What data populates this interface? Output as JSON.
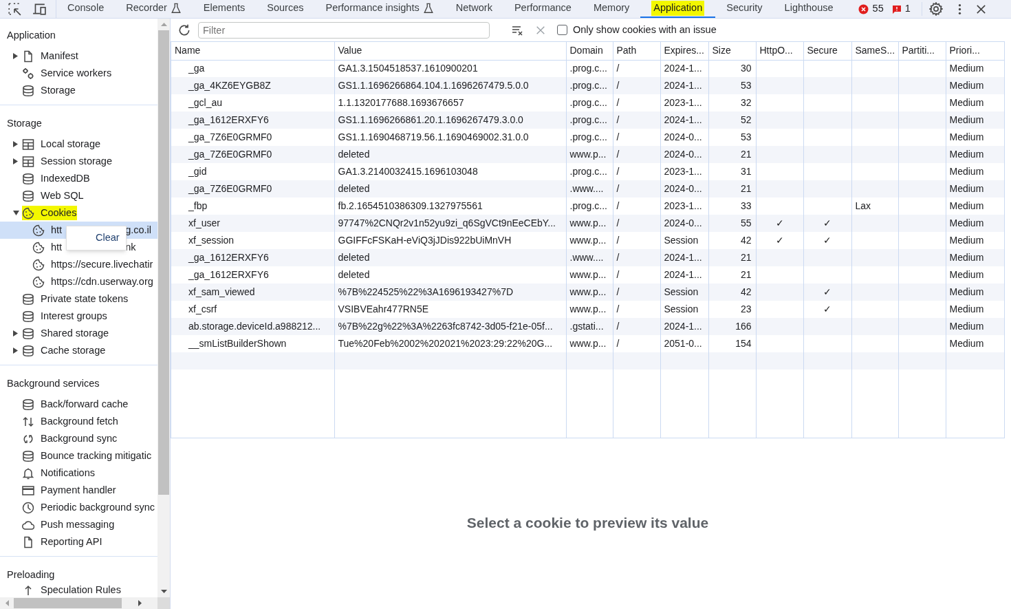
{
  "tabs": [
    {
      "label": "Console",
      "selected": false,
      "experimental": false,
      "highlighted": false
    },
    {
      "label": "Recorder",
      "selected": false,
      "experimental": true,
      "highlighted": false
    },
    {
      "label": "Elements",
      "selected": false,
      "experimental": false,
      "highlighted": false
    },
    {
      "label": "Sources",
      "selected": false,
      "experimental": false,
      "highlighted": false
    },
    {
      "label": "Performance insights",
      "selected": false,
      "experimental": true,
      "highlighted": false
    },
    {
      "label": "Network",
      "selected": false,
      "experimental": false,
      "highlighted": false
    },
    {
      "label": "Performance",
      "selected": false,
      "experimental": false,
      "highlighted": false
    },
    {
      "label": "Memory",
      "selected": false,
      "experimental": false,
      "highlighted": false
    },
    {
      "label": "Application",
      "selected": true,
      "experimental": false,
      "highlighted": true
    },
    {
      "label": "Security",
      "selected": false,
      "experimental": false,
      "highlighted": false
    },
    {
      "label": "Lighthouse",
      "selected": false,
      "experimental": false,
      "highlighted": false
    }
  ],
  "counters": {
    "errors": "55",
    "issues": "1"
  },
  "sidebar": {
    "sections": [
      {
        "title": "Application",
        "items": [
          {
            "label": "Manifest",
            "kind": "file",
            "expanded": false
          },
          {
            "label": "Service workers",
            "kind": "gears"
          },
          {
            "label": "Storage",
            "kind": "database"
          }
        ]
      },
      {
        "title": "Storage",
        "items": [
          {
            "label": "Local storage",
            "kind": "grid",
            "expanded": false
          },
          {
            "label": "Session storage",
            "kind": "grid",
            "expanded": false
          },
          {
            "label": "IndexedDB",
            "kind": "database"
          },
          {
            "label": "Web SQL",
            "kind": "database"
          },
          {
            "label": "Cookies",
            "kind": "cookie",
            "expanded": true,
            "highlighted": true,
            "children": [
              {
                "label_start": "htt",
                "label_end": "g.co.il",
                "selected": true
              },
              {
                "label_start": "htt",
                "label_end": "nk",
                "selected": false
              },
              {
                "label_start": "https://secure.livechatir",
                "selected": false
              },
              {
                "label_start": "https://cdn.userway.org",
                "selected": false
              }
            ]
          },
          {
            "label": "Private state tokens",
            "kind": "database"
          },
          {
            "label": "Interest groups",
            "kind": "database"
          },
          {
            "label": "Shared storage",
            "kind": "database",
            "expanded": false
          },
          {
            "label": "Cache storage",
            "kind": "database",
            "expanded": false
          }
        ]
      },
      {
        "title": "Background services",
        "items": [
          {
            "label": "Back/forward cache",
            "kind": "database"
          },
          {
            "label": "Background fetch",
            "kind": "updown"
          },
          {
            "label": "Background sync",
            "kind": "sync"
          },
          {
            "label": "Bounce tracking mitigatic",
            "kind": "database"
          },
          {
            "label": "Notifications",
            "kind": "bell"
          },
          {
            "label": "Payment handler",
            "kind": "card"
          },
          {
            "label": "Periodic background sync",
            "kind": "clock"
          },
          {
            "label": "Push messaging",
            "kind": "cloud"
          },
          {
            "label": "Reporting API",
            "kind": "file"
          }
        ]
      },
      {
        "title": "Preloading",
        "items": [
          {
            "label": "Speculation Rules",
            "kind": "up"
          }
        ]
      }
    ]
  },
  "context_menu": {
    "items": [
      "Clear"
    ]
  },
  "filter": {
    "placeholder": "Filter"
  },
  "issue_filter": {
    "label": "Only show cookies with an issue",
    "checked": false
  },
  "table": {
    "columns": [
      "Name",
      "Value",
      "Domain",
      "Path",
      "Expires...",
      "Size",
      "HttpO...",
      "Secure",
      "SameS...",
      "Partiti...",
      "Priori..."
    ],
    "rows": [
      [
        "_ga",
        "GA1.3.1504518537.1610900201",
        ".prog.c...",
        "/",
        "2024-1...",
        "30",
        "",
        "",
        "",
        "",
        "Medium"
      ],
      [
        "_ga_4KZ6EYGB8Z",
        "GS1.1.1696266864.104.1.1696267479.5.0.0",
        ".prog.c...",
        "/",
        "2024-1...",
        "53",
        "",
        "",
        "",
        "",
        "Medium"
      ],
      [
        "_gcl_au",
        "1.1.1320177688.1693676657",
        ".prog.c...",
        "/",
        "2023-1...",
        "32",
        "",
        "",
        "",
        "",
        "Medium"
      ],
      [
        "_ga_1612ERXFY6",
        "GS1.1.1696266861.20.1.1696267479.3.0.0",
        ".prog.c...",
        "/",
        "2024-1...",
        "52",
        "",
        "",
        "",
        "",
        "Medium"
      ],
      [
        "_ga_7Z6E0GRMF0",
        "GS1.1.1690468719.56.1.1690469002.31.0.0",
        ".prog.c...",
        "/",
        "2024-0...",
        "53",
        "",
        "",
        "",
        "",
        "Medium"
      ],
      [
        "_ga_7Z6E0GRMF0",
        "deleted",
        "www.p...",
        "/",
        "2024-0...",
        "21",
        "",
        "",
        "",
        "",
        "Medium"
      ],
      [
        "_gid",
        "GA1.3.2140032415.1696103048",
        ".prog.c...",
        "/",
        "2023-1...",
        "31",
        "",
        "",
        "",
        "",
        "Medium"
      ],
      [
        "_ga_7Z6E0GRMF0",
        "deleted",
        ".www....",
        "/",
        "2024-0...",
        "21",
        "",
        "",
        "",
        "",
        "Medium"
      ],
      [
        "_fbp",
        "fb.2.1654510386309.1327975561",
        ".prog.c...",
        "/",
        "2023-1...",
        "33",
        "",
        "",
        "Lax",
        "",
        "Medium"
      ],
      [
        "xf_user",
        "97747%2CNQr2v1n52yu9zi_q6SgVCt9nEeCEbY...",
        "www.p...",
        "/",
        "2024-0...",
        "55",
        "✓",
        "✓",
        "",
        "",
        "Medium"
      ],
      [
        "xf_session",
        "GGIFFcFSKaH-eViQ3jJDis922bUiMnVH",
        "www.p...",
        "/",
        "Session",
        "42",
        "✓",
        "✓",
        "",
        "",
        "Medium"
      ],
      [
        "_ga_1612ERXFY6",
        "deleted",
        ".www....",
        "/",
        "2024-1...",
        "21",
        "",
        "",
        "",
        "",
        "Medium"
      ],
      [
        "_ga_1612ERXFY6",
        "deleted",
        "www.p...",
        "/",
        "2024-1...",
        "21",
        "",
        "",
        "",
        "",
        "Medium"
      ],
      [
        "xf_sam_viewed",
        "%7B%224525%22%3A1696193427%7D",
        "www.p...",
        "/",
        "Session",
        "42",
        "",
        "✓",
        "",
        "",
        "Medium"
      ],
      [
        "xf_csrf",
        "VSIBVEahr477RN5E",
        "www.p...",
        "/",
        "Session",
        "23",
        "",
        "✓",
        "",
        "",
        "Medium"
      ],
      [
        "ab.storage.deviceId.a988212...",
        "%7B%22g%22%3A%2263fc8742-3d05-f21e-05f...",
        ".gstati...",
        "/",
        "2024-1...",
        "166",
        "",
        "",
        "",
        "",
        "Medium"
      ],
      [
        "__smListBuilderShown",
        "Tue%20Feb%2002%202021%2023:29:22%20G...",
        "www.p...",
        "/",
        "2051-0...",
        "154",
        "",
        "",
        "",
        "",
        "Medium"
      ]
    ]
  },
  "preview": {
    "message": "Select a cookie to preview its value"
  }
}
